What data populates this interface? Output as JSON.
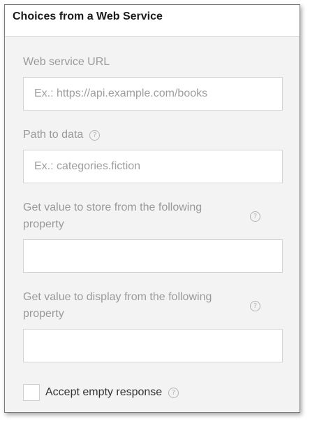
{
  "panel": {
    "title": "Choices from a Web Service"
  },
  "fields": {
    "url": {
      "label": "Web service URL",
      "value": "",
      "placeholder": "Ex.: https://api.example.com/books"
    },
    "path": {
      "label": "Path to data",
      "value": "",
      "placeholder": "Ex.: categories.fiction"
    },
    "value_property": {
      "label": "Get value to store from the following property",
      "value": "",
      "placeholder": ""
    },
    "display_property": {
      "label": "Get value to display from the following property",
      "value": "",
      "placeholder": ""
    }
  },
  "accept_empty": {
    "label": "Accept empty response",
    "checked": false
  },
  "icons": {
    "help": "?"
  },
  "colors": {
    "label": "#9a9a9a",
    "panel_background": "#f3f3f3",
    "input_border": "#d4d4d4"
  }
}
